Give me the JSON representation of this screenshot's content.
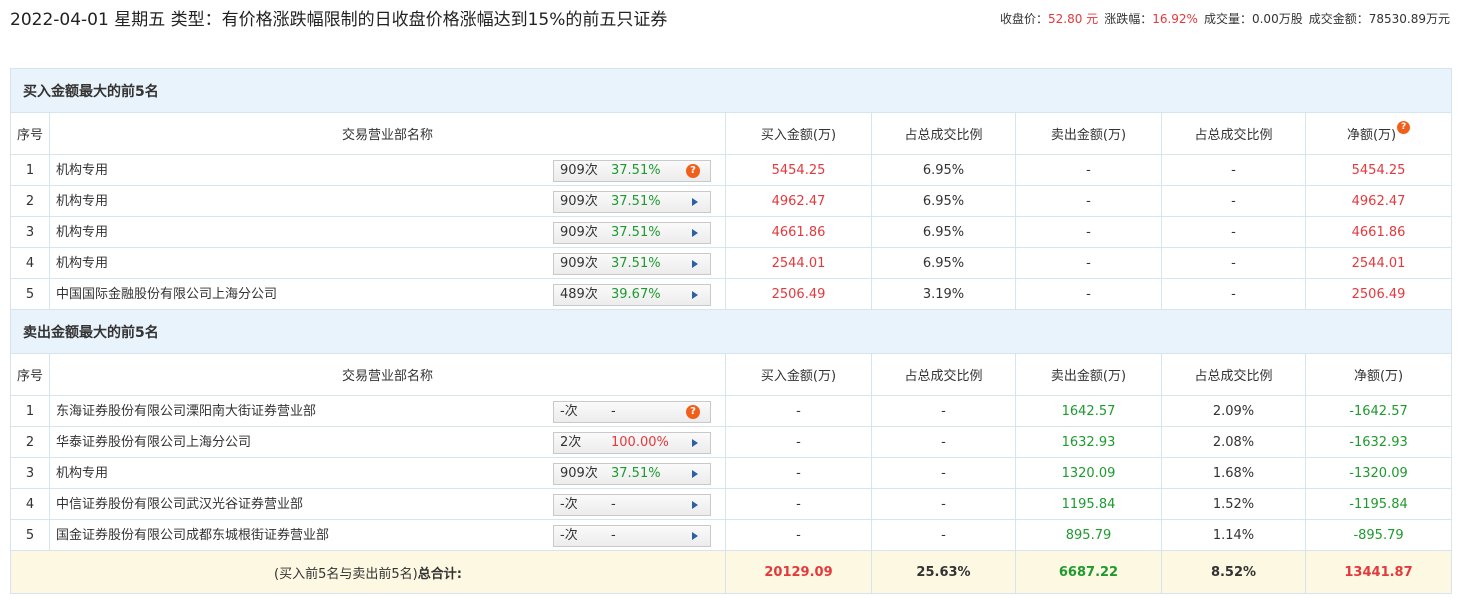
{
  "header": {
    "title": "2022-04-01 星期五 类型：有价格涨跌幅限制的日收盘价格涨幅达到15%的前五只证券",
    "close_label": "收盘价：",
    "close_value": "52.80 元",
    "change_label": "涨跌幅：",
    "change_value": "16.92%",
    "volume_label": "成交量：",
    "volume_value": "0.00万股",
    "turnover_label": "成交金额：",
    "turnover_value": "78530.89万元"
  },
  "columns": [
    "序号",
    "交易营业部名称",
    "买入金额(万)",
    "占总成交比例",
    "卖出金额(万)",
    "占总成交比例",
    "净额(万)"
  ],
  "buy_section": {
    "title": "买入金额最大的前5名",
    "rows": [
      {
        "idx": "1",
        "name": "机构专用",
        "count": "909次",
        "pct": "37.51%",
        "pct_color": "green",
        "icon": "question",
        "buy": "5454.25",
        "buy_ratio": "6.95%",
        "sell": "-",
        "sell_ratio": "-",
        "net": "5454.25"
      },
      {
        "idx": "2",
        "name": "机构专用",
        "count": "909次",
        "pct": "37.51%",
        "pct_color": "green",
        "icon": "arrow",
        "buy": "4962.47",
        "buy_ratio": "6.95%",
        "sell": "-",
        "sell_ratio": "-",
        "net": "4962.47"
      },
      {
        "idx": "3",
        "name": "机构专用",
        "count": "909次",
        "pct": "37.51%",
        "pct_color": "green",
        "icon": "arrow",
        "buy": "4661.86",
        "buy_ratio": "6.95%",
        "sell": "-",
        "sell_ratio": "-",
        "net": "4661.86"
      },
      {
        "idx": "4",
        "name": "机构专用",
        "count": "909次",
        "pct": "37.51%",
        "pct_color": "green",
        "icon": "arrow",
        "buy": "2544.01",
        "buy_ratio": "6.95%",
        "sell": "-",
        "sell_ratio": "-",
        "net": "2544.01"
      },
      {
        "idx": "5",
        "name": "中国国际金融股份有限公司上海分公司",
        "count": "489次",
        "pct": "39.67%",
        "pct_color": "green",
        "icon": "arrow",
        "buy": "2506.49",
        "buy_ratio": "3.19%",
        "sell": "-",
        "sell_ratio": "-",
        "net": "2506.49"
      }
    ]
  },
  "sell_section": {
    "title": "卖出金额最大的前5名",
    "rows": [
      {
        "idx": "1",
        "name": "东海证券股份有限公司溧阳南大街证券营业部",
        "count": "-次",
        "pct": "-",
        "pct_color": "plain",
        "icon": "question",
        "buy": "-",
        "buy_ratio": "-",
        "sell": "1642.57",
        "sell_ratio": "2.09%",
        "net": "-1642.57"
      },
      {
        "idx": "2",
        "name": "华泰证券股份有限公司上海分公司",
        "count": "2次",
        "pct": "100.00%",
        "pct_color": "red",
        "icon": "arrow",
        "buy": "-",
        "buy_ratio": "-",
        "sell": "1632.93",
        "sell_ratio": "2.08%",
        "net": "-1632.93"
      },
      {
        "idx": "3",
        "name": "机构专用",
        "count": "909次",
        "pct": "37.51%",
        "pct_color": "green",
        "icon": "arrow",
        "buy": "-",
        "buy_ratio": "-",
        "sell": "1320.09",
        "sell_ratio": "1.68%",
        "net": "-1320.09"
      },
      {
        "idx": "4",
        "name": "中信证券股份有限公司武汉光谷证券营业部",
        "count": "-次",
        "pct": "-",
        "pct_color": "plain",
        "icon": "arrow",
        "buy": "-",
        "buy_ratio": "-",
        "sell": "1195.84",
        "sell_ratio": "1.52%",
        "net": "-1195.84"
      },
      {
        "idx": "5",
        "name": "国金证券股份有限公司成都东城根街证券营业部",
        "count": "-次",
        "pct": "-",
        "pct_color": "plain",
        "icon": "arrow",
        "buy": "-",
        "buy_ratio": "-",
        "sell": "895.79",
        "sell_ratio": "1.14%",
        "net": "-895.79"
      }
    ]
  },
  "total": {
    "label_prefix": "(买入前5名与卖出前5名)",
    "label_bold": "总合计:",
    "buy": "20129.09",
    "buy_ratio": "25.63%",
    "sell": "6687.22",
    "sell_ratio": "8.52%",
    "net": "13441.87"
  },
  "colors": {
    "red": "#e4393c",
    "green": "#1e9a2f",
    "section_bg": "#e9f3fb",
    "total_bg": "#fdf8e2",
    "border": "#d6e4ee"
  }
}
